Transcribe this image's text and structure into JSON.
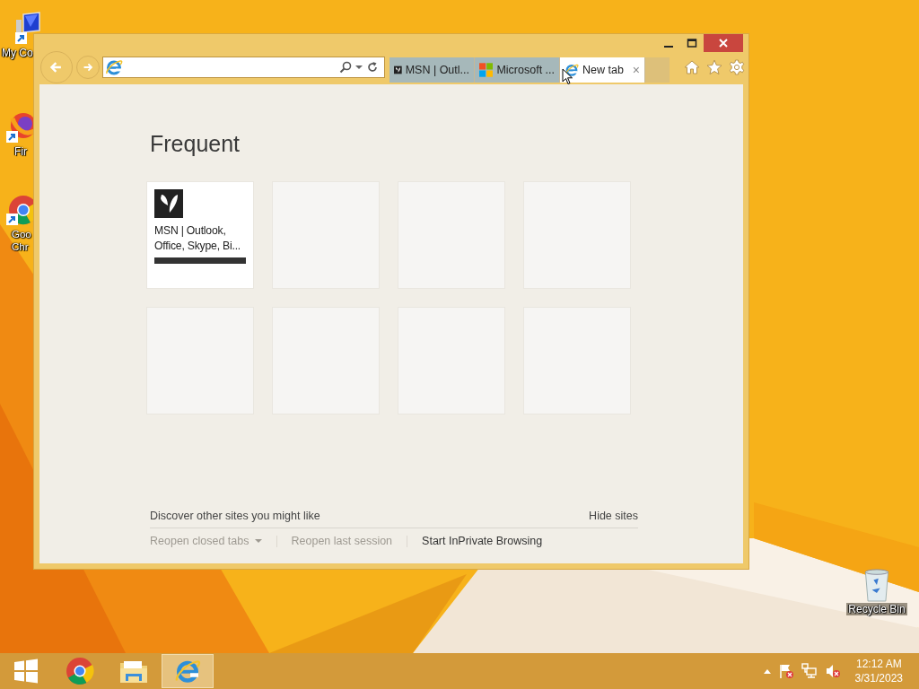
{
  "desktop_icons": [
    {
      "label": "My Co",
      "kind": "computer"
    },
    {
      "label": "Fir",
      "kind": "fox"
    },
    {
      "label": "Goo Chr",
      "kind": "chrome"
    },
    {
      "label": "Recycle Bin",
      "kind": "bin"
    }
  ],
  "window": {
    "tabs": [
      {
        "label": "MSN | Outl...",
        "kind": "butterfly",
        "selected": false
      },
      {
        "label": "Microsoft ...",
        "kind": "squares",
        "selected": false
      },
      {
        "label": "New tab",
        "kind": "browser",
        "selected": true,
        "close": "×"
      }
    ],
    "heading": "Frequent",
    "tiles": [
      {
        "kind": "site",
        "title": "MSN | Outlook, Office, Skype, Bi..."
      },
      {
        "kind": "empty"
      },
      {
        "kind": "empty"
      },
      {
        "kind": "empty"
      },
      {
        "kind": "empty"
      },
      {
        "kind": "empty"
      },
      {
        "kind": "empty"
      },
      {
        "kind": "empty"
      }
    ],
    "discover": "Discover other sites you might like",
    "hide_sites": "Hide sites",
    "footer_links": [
      {
        "label": "Reopen closed tabs",
        "disabled": true,
        "dropdown": true
      },
      {
        "label": "Reopen last session",
        "disabled": true,
        "dropdown": false
      },
      {
        "label": "Start InPrivate Browsing",
        "disabled": false,
        "dropdown": false
      }
    ]
  },
  "taskbar": {
    "apps": [
      {
        "kind": "start",
        "active": false
      },
      {
        "kind": "chrome",
        "active": false
      },
      {
        "kind": "folder",
        "active": false
      },
      {
        "kind": "browser",
        "active": true
      }
    ],
    "tray": {
      "time": "12:12 AM",
      "date": "3/31/2023"
    }
  }
}
